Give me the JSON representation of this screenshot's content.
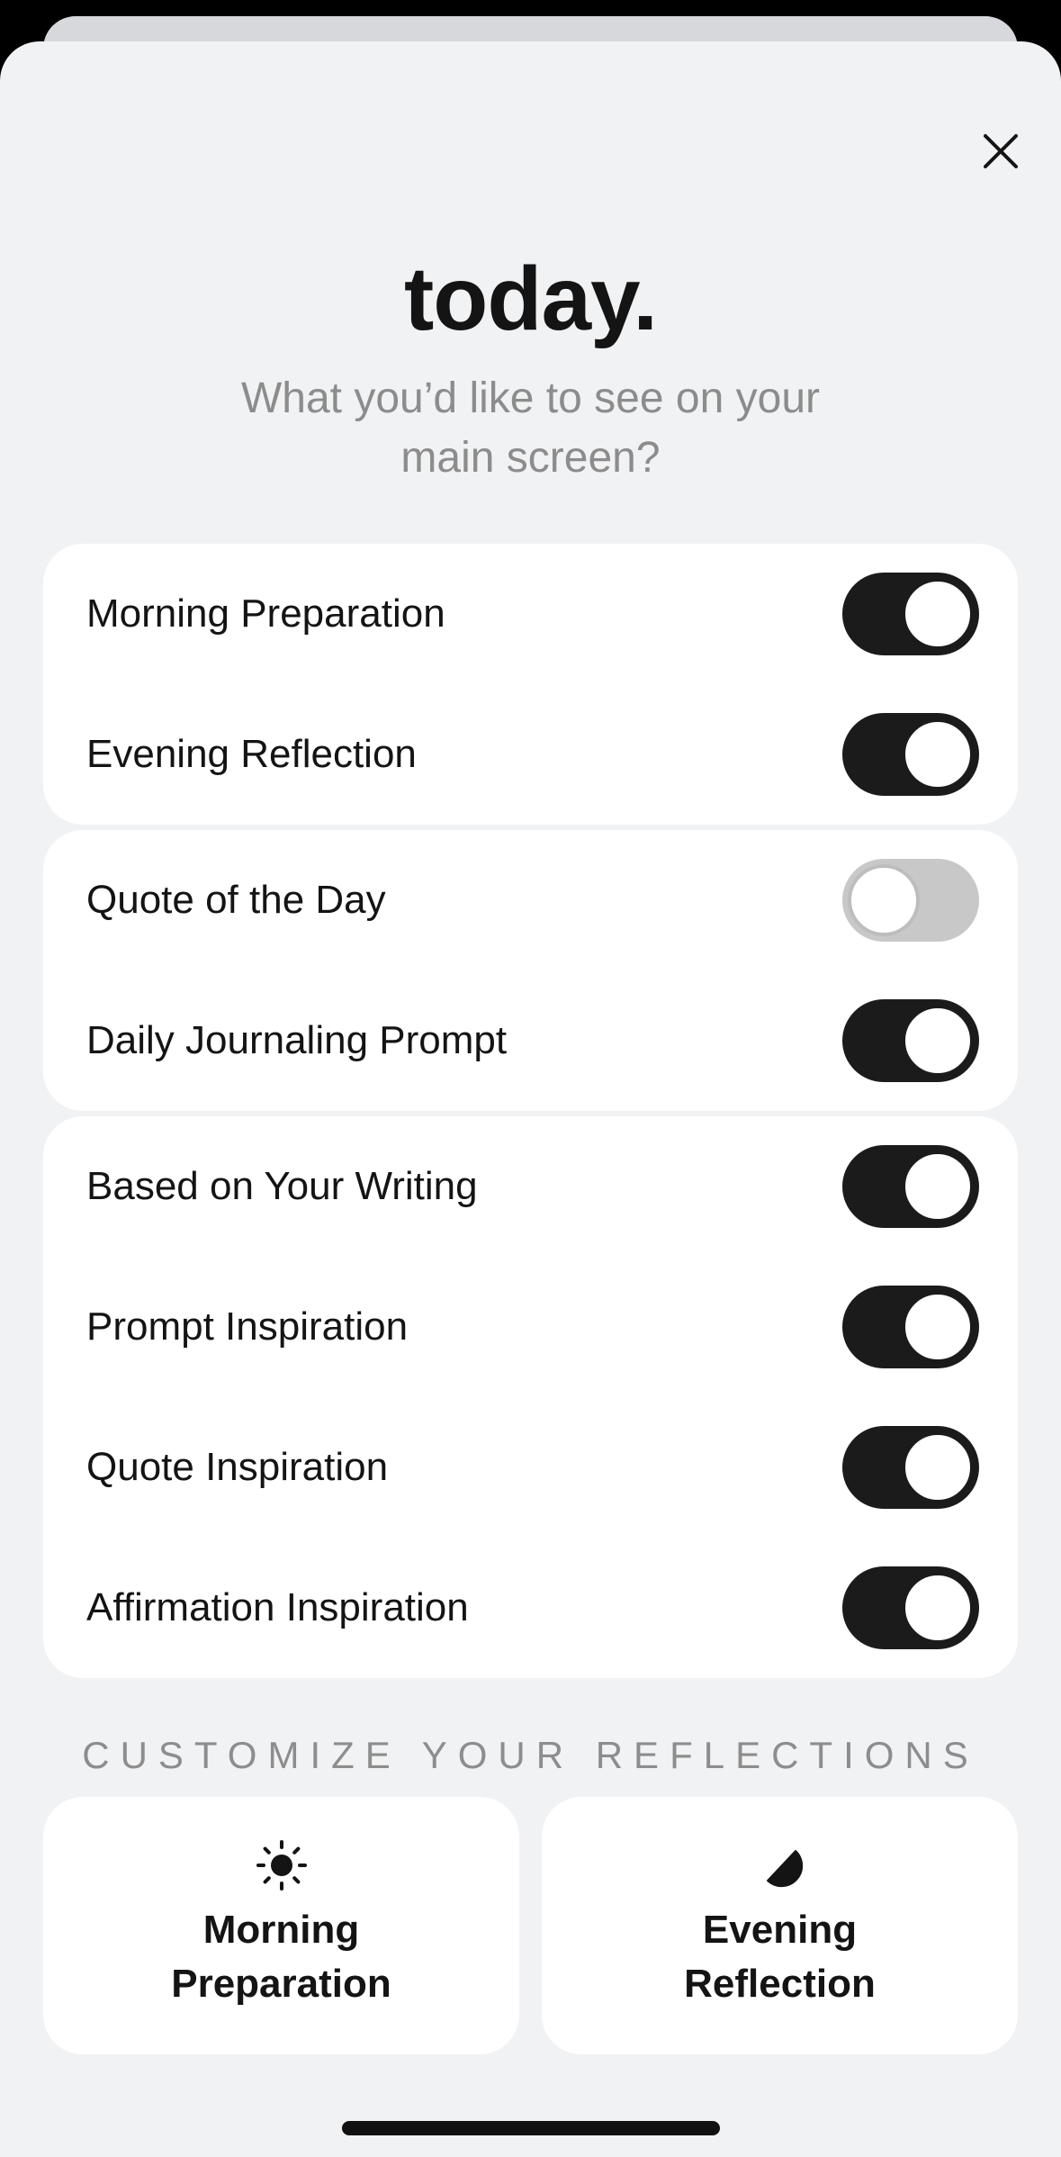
{
  "colors": {
    "toggle_on": "#1b1b1b",
    "toggle_off": "#c8c8c8",
    "background": "#f1f2f4",
    "card": "#ffffff",
    "muted_text": "#8c8c8c"
  },
  "header": {
    "title": "today.",
    "subtitle": "What you’d like to see on your main screen?",
    "close_icon": "close-icon"
  },
  "groups": [
    {
      "items": [
        {
          "label": "Morning Preparation",
          "enabled": true
        },
        {
          "label": "Evening Reflection",
          "enabled": true
        }
      ]
    },
    {
      "items": [
        {
          "label": "Quote of the Day",
          "enabled": false
        },
        {
          "label": "Daily Journaling Prompt",
          "enabled": true
        }
      ]
    },
    {
      "items": [
        {
          "label": "Based on Your Writing",
          "enabled": true
        },
        {
          "label": "Prompt Inspiration",
          "enabled": true
        },
        {
          "label": "Quote Inspiration",
          "enabled": true
        },
        {
          "label": "Affirmation Inspiration",
          "enabled": true
        }
      ]
    }
  ],
  "customize": {
    "header": "CUSTOMIZE YOUR REFLECTIONS",
    "tiles": [
      {
        "icon": "sun-icon",
        "line1": "Morning",
        "line2": "Preparation"
      },
      {
        "icon": "half-moon-icon",
        "line1": "Evening",
        "line2": "Reflection"
      }
    ]
  }
}
